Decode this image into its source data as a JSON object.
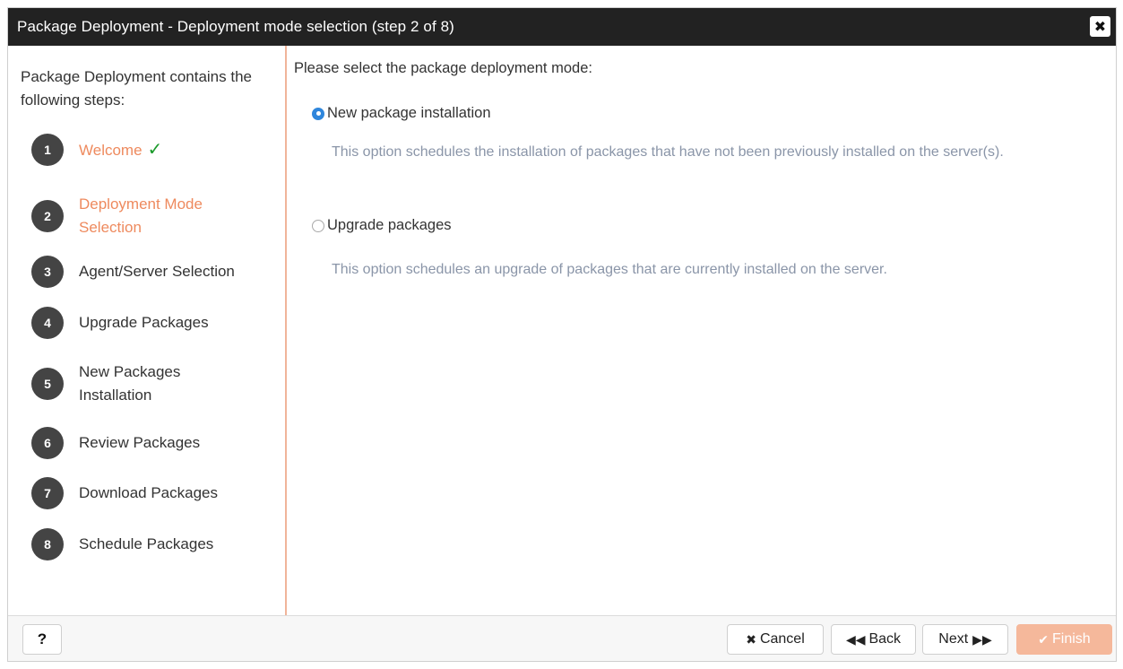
{
  "window": {
    "title": "Package Deployment - Deployment mode selection (step 2 of 8)",
    "close_icon": "✖"
  },
  "sidebar": {
    "intro": "Package Deployment contains the following steps:",
    "steps": [
      {
        "num": "1",
        "label": "Welcome",
        "status": "done"
      },
      {
        "num": "2",
        "label": "Deployment Mode Selection",
        "status": "active"
      },
      {
        "num": "3",
        "label": "Agent/Server Selection",
        "status": "pending"
      },
      {
        "num": "4",
        "label": "Upgrade Packages",
        "status": "pending"
      },
      {
        "num": "5",
        "label": "New Packages Installation",
        "status": "pending"
      },
      {
        "num": "6",
        "label": "Review Packages",
        "status": "pending"
      },
      {
        "num": "7",
        "label": "Download Packages",
        "status": "pending"
      },
      {
        "num": "8",
        "label": "Schedule Packages",
        "status": "pending"
      }
    ],
    "check_glyph": "✓"
  },
  "main": {
    "prompt": "Please select the package deployment mode:",
    "options": [
      {
        "label": "New package installation",
        "checked": true,
        "description": "This option schedules the installation of packages that have not been previously installed on the server(s)."
      },
      {
        "label": "Upgrade packages",
        "checked": false,
        "description": "This option schedules an upgrade of packages that are currently installed on the server."
      }
    ]
  },
  "footer": {
    "help_label": "?",
    "cancel_label": "Cancel",
    "cancel_icon": "✖",
    "back_label": "Back",
    "back_icon": "◀◀",
    "next_label": "Next",
    "next_icon": "▶▶",
    "finish_label": "Finish",
    "finish_icon": "✔",
    "finish_enabled": false
  },
  "colors": {
    "accent_orange": "#ee8a5e",
    "radio_blue": "#2f86dc",
    "title_bar": "#222222",
    "step_circle": "#444444",
    "description_text": "#8a95a8"
  }
}
